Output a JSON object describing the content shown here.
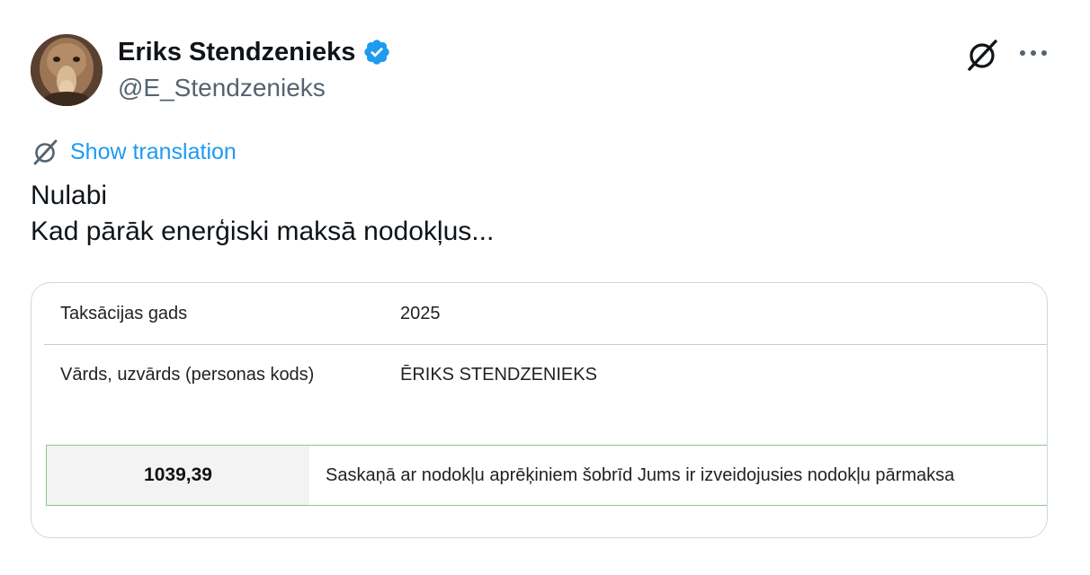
{
  "author": {
    "name": "Eriks Stendzenieks",
    "handle": "@E_Stendzenieks",
    "verified": true,
    "verified_color": "#1d9bf0"
  },
  "actions": {
    "grok_icon": "grok-icon",
    "more_icon": "more-icon"
  },
  "translation": {
    "label": "Show translation",
    "color": "#1d9bf0"
  },
  "tweet": {
    "lines": [
      "Nulabi",
      "Kad pārāk enerģiski maksā nodokļus..."
    ]
  },
  "document": {
    "rows": [
      {
        "label": "Taksācijas gads",
        "value": "2025"
      },
      {
        "label": "Vārds, uzvārds (personas kods)",
        "value": "ĒRIKS STENDZENIEKS"
      }
    ],
    "summary": {
      "amount": "1039,39",
      "text": "Saskaņā ar nodokļu aprēķiniem šobrīd Jums ir izveidojusies nodokļu pārmaksa",
      "border_color": "#8cc78c"
    }
  }
}
